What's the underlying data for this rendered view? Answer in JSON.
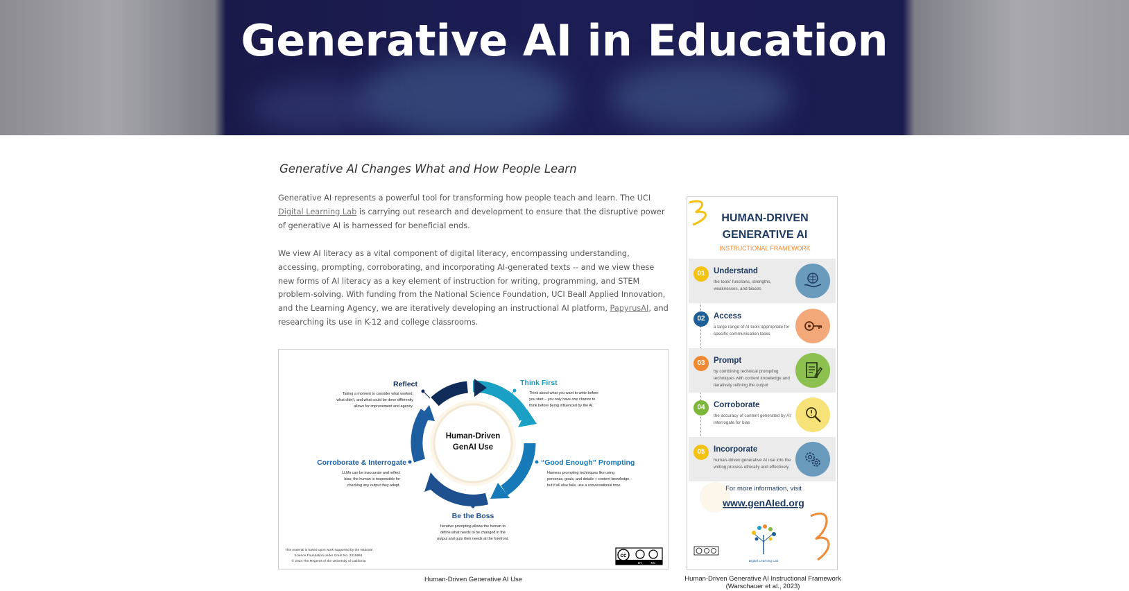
{
  "hero": {
    "title": "Generative AI in Education"
  },
  "intro": {
    "subtitle": "Generative AI Changes What and How People Learn",
    "p1_a": "Generative AI represents a powerful tool for transforming how people teach and learn. The UCI ",
    "p1_link": "Digital Learning Lab",
    "p1_b": " is carrying out research and development to ensure that the disruptive power of generative AI is harnessed for beneficial ends.",
    "p2_a": "We view AI literacy as a vital component of digital literacy, encompassing understanding, accessing, prompting, corroborating, and incorporating AI-generated texts -- and we view these new forms of AI literacy as a key element of instruction for writing, programming, and STEM problem-solving.  With funding from the National Science Foundation, UCI Beall Applied Innovation, and the Learning Agency, we are iteratively developing an instructional AI platform, ",
    "p2_link": "PapyrusAI",
    "p2_b": ", and researching its use in K-12 and college classrooms."
  },
  "figure1": {
    "center_line1": "Human-Driven",
    "center_line2": "GenAI Use",
    "reflect": {
      "title": "Reflect",
      "l1": "Taking a moment to consider what worked,",
      "l2": "what didn't, and what could be done differently",
      "l3": "allows for improvement and agency."
    },
    "think": {
      "title": "Think First",
      "l1": "Think about what you want to write before",
      "l2": "you start – you only have one chance to",
      "l3": "think before being influenced by the AI."
    },
    "prompting": {
      "title": "“Good Enough” Prompting",
      "l1": "Harness prompting techniques like using",
      "l2": "personas, goals, and details + content knowledge,",
      "l3": "but if all else fails, use a conversational tone."
    },
    "boss": {
      "title": "Be the Boss",
      "l1": "Iterative prompting allows the human to",
      "l2": "define what needs to be changed in the",
      "l3": "output and puts their needs at the forefront."
    },
    "corroborate": {
      "title": "Corroborate & Interrogate",
      "l1": "LLMs can be inaccurate and reflect",
      "l2": "bias; the human is responsible for",
      "l3": "checking any output they adopt."
    },
    "footnote_l1": "This material is based upon work supported by the National",
    "footnote_l2": "Science Foundation under Grant No. 2315984.",
    "footnote_l3": "© 2024 The Regents of the University of California",
    "license": {
      "cc": "cc",
      "by": "BY",
      "nc": "NC"
    },
    "caption": "Human-Driven Generative AI Use"
  },
  "figure2": {
    "title_l1": "HUMAN-DRIVEN",
    "title_l2": "GENERATIVE AI",
    "subtitle": "INSTRUCTIONAL FRAMEWORK",
    "steps": [
      {
        "num": "01",
        "title": "Understand",
        "desc": "the tools' functions, strengths, weaknesses, and biases",
        "color": "#f2c112",
        "icon_bg": "#6a9bbd",
        "icon": "brain-hand-icon"
      },
      {
        "num": "02",
        "title": "Access",
        "desc": "a large range of AI tools appropriate for specific communication tasks",
        "color": "#1f5f97",
        "icon_bg": "#f3a87a",
        "icon": "key-icon"
      },
      {
        "num": "03",
        "title": "Prompt",
        "desc": "by combining technical prompting techniques with content knowledge and iteratively refining the output",
        "color": "#ef8a33",
        "icon_bg": "#8cc04f",
        "icon": "notepad-pen-icon"
      },
      {
        "num": "04",
        "title": "Corroborate",
        "desc": "the accuracy of content generated by AI; interrogate for bias",
        "color": "#7cb63a",
        "icon_bg": "#f7e27a",
        "icon": "magnifier-icon"
      },
      {
        "num": "05",
        "title": "Incorporate",
        "desc": "human-driven generative AI use into the writing process ethically and effectively",
        "color": "#f2c112",
        "icon_bg": "#6a9bbd",
        "icon": "gears-icon"
      }
    ],
    "more_info": "For more information, visit",
    "url": "www.genAIed.org",
    "lab_label": "Digital Learning Lab",
    "caption_l1": "Human-Driven Generative AI Instructional Framework",
    "caption_l2": "(Warschauer et al., 2023)"
  }
}
